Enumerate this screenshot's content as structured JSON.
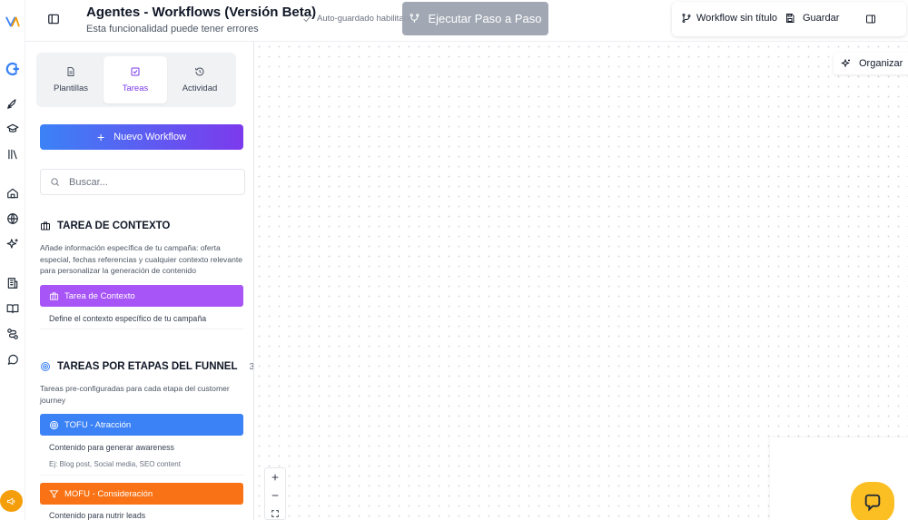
{
  "header": {
    "title": "Agentes - Workflows (Versión Beta)",
    "subtitle": "Esta funcionalidad puede tener errores",
    "autosave": "Auto-guardado habilitado",
    "run_step": "Ejecutar Paso a Paso",
    "workflow_name": "Workflow sin título",
    "save": "Guardar"
  },
  "tabs": [
    {
      "label": "Plantillas",
      "icon": "file-icon"
    },
    {
      "label": "Tareas",
      "icon": "check-square-icon",
      "active": true
    },
    {
      "label": "Actividad",
      "icon": "history-icon"
    }
  ],
  "sidebar": {
    "new_workflow": "Nuevo Workflow",
    "search_placeholder": "Buscar..."
  },
  "context_section": {
    "title": "TAREA DE CONTEXTO",
    "description": "Añade información específica de tu campaña: oferta especial, fechas referencias y cualquier contexto relevante para personalizar la generación de contenido",
    "task": {
      "label": "Tarea de Contexto",
      "color": "#a855f7",
      "description": "Define el contexto específico de tu campaña"
    }
  },
  "funnel_section": {
    "title": "TAREAS POR ETAPAS DEL FUNNEL",
    "count": "3",
    "description": "Tareas pre-configuradas para cada etapa del customer journey",
    "tasks": [
      {
        "label": "TOFU - Atracción",
        "color": "#3b82f6",
        "description": "Contenido para generar awareness",
        "example": "Ej: Blog post, Social media, SEO content"
      },
      {
        "label": "MOFU - Consideración",
        "color": "#f97316",
        "description": "Contenido para nutrir leads"
      }
    ]
  },
  "canvas": {
    "organize": "Organizar"
  },
  "colors": {
    "accent": "#7c3aed",
    "primary_gradient_start": "#3b82f6",
    "primary_gradient_end": "#7c3aed",
    "chat": "#fbbf24",
    "announce": "#f59e0b"
  },
  "rail_icons": [
    "logo-icon",
    "c-plus-icon",
    "rocket-icon",
    "graduation-cap-icon",
    "library-icon",
    "home-icon",
    "globe-icon",
    "sparkles-icon",
    "building-icon",
    "book-icon",
    "route-icon",
    "chat-bubble-icon",
    "megaphone-icon"
  ]
}
